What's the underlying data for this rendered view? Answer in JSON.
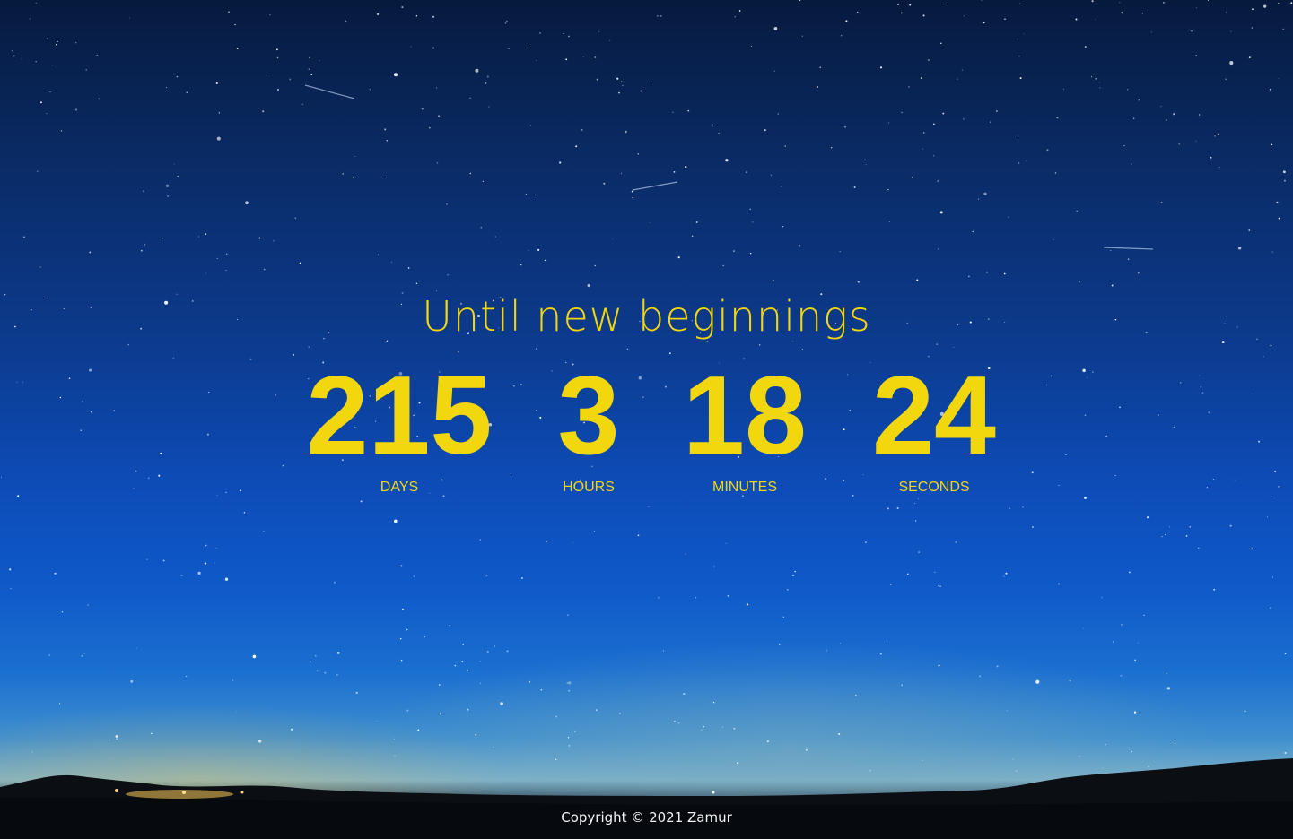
{
  "headline": "Until new beginnings",
  "countdown": [
    {
      "value": "215",
      "unit": "DAYS"
    },
    {
      "value": "3",
      "unit": "HOURS"
    },
    {
      "value": "18",
      "unit": "MINUTES"
    },
    {
      "value": "24",
      "unit": "SECONDS"
    }
  ],
  "footer": {
    "copyright": "Copyright © 2021 Zamur"
  },
  "colors": {
    "accent": "#f2d70f",
    "footer_text": "#f3f3f3"
  }
}
